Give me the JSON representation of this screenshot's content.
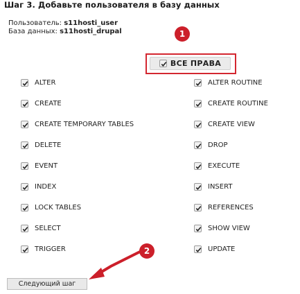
{
  "step_title": "Шаг 3. Добавьте пользователя в базу данных",
  "info": {
    "user_label": "Пользователь:",
    "user_value": "s11hosti_user",
    "db_label": "База данных:",
    "db_value": "s11hosti_drupal"
  },
  "all_rights": {
    "label": "ВСЕ ПРАВА",
    "checked": true
  },
  "permissions_left": [
    {
      "label": "ALTER",
      "checked": true
    },
    {
      "label": "CREATE",
      "checked": true
    },
    {
      "label": "CREATE TEMPORARY TABLES",
      "checked": true
    },
    {
      "label": "DELETE",
      "checked": true
    },
    {
      "label": "EVENT",
      "checked": true
    },
    {
      "label": "INDEX",
      "checked": true
    },
    {
      "label": "LOCK TABLES",
      "checked": true
    },
    {
      "label": "SELECT",
      "checked": true
    },
    {
      "label": "TRIGGER",
      "checked": true
    }
  ],
  "permissions_right": [
    {
      "label": "ALTER ROUTINE",
      "checked": true
    },
    {
      "label": "CREATE ROUTINE",
      "checked": true
    },
    {
      "label": "CREATE VIEW",
      "checked": true
    },
    {
      "label": "DROP",
      "checked": true
    },
    {
      "label": "EXECUTE",
      "checked": true
    },
    {
      "label": "INSERT",
      "checked": true
    },
    {
      "label": "REFERENCES",
      "checked": true
    },
    {
      "label": "SHOW VIEW",
      "checked": true
    },
    {
      "label": "UPDATE",
      "checked": true
    }
  ],
  "annotations": {
    "badge1": "1",
    "badge2": "2"
  },
  "next_button": {
    "label": "Следующий шаг"
  },
  "colors": {
    "annotation_red": "#cc1f2a",
    "checkmark": "#222222",
    "button_bg": "#e9e9e9"
  },
  "icons": {
    "checkbox": "checkbox-checked-icon",
    "arrow": "arrow-icon"
  }
}
